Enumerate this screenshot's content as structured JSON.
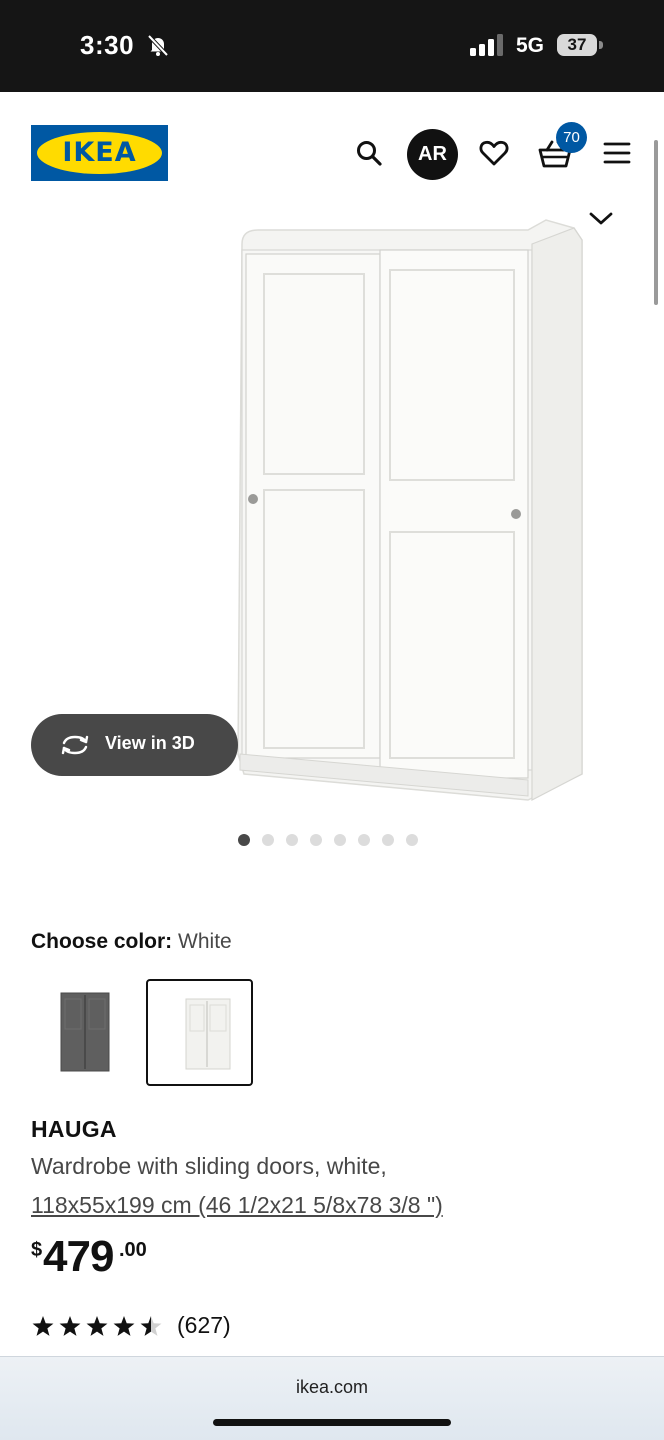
{
  "status_bar": {
    "time": "3:30",
    "network": "5G",
    "battery": "37",
    "icons": [
      "bell-slash-icon",
      "signal-icon",
      "battery-icon"
    ]
  },
  "header": {
    "logo_text": "IKEA",
    "ar_label": "AR",
    "cart_count": "70",
    "icons": [
      "search-icon",
      "heart-icon",
      "basket-icon",
      "menu-icon",
      "chevron-down-icon"
    ],
    "brand_colors": {
      "blue": "#0058a3",
      "yellow": "#ffdb00"
    }
  },
  "gallery": {
    "view3d_label": "View in 3D",
    "total_images": 8,
    "active_index": 0
  },
  "color_choice": {
    "label": "Choose color:",
    "selected": "White",
    "options": [
      "dark-gray-wardrobe",
      "white-wardrobe"
    ]
  },
  "product": {
    "name": "HAUGA",
    "description": "Wardrobe with sliding doors, white,",
    "dimensions": "118x55x199 cm (46 1/2x21 5/8x78 3/8 \")",
    "price_currency": "$",
    "price_integer": "479",
    "price_decimal": ".00",
    "rating_stars": 4.5,
    "rating_count": "(627)"
  },
  "browser": {
    "url": "ikea.com"
  }
}
